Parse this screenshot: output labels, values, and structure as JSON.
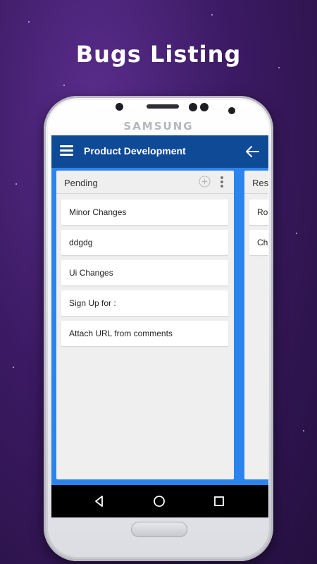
{
  "headline": "Bugs Listing",
  "device": {
    "brand": "SAMSUNG"
  },
  "appbar": {
    "title": "Product Development",
    "color": "#0f4a97"
  },
  "board": {
    "background": "#2b83ee",
    "columns": [
      {
        "title": "Pending",
        "cards": [
          "Minor Changes",
          "ddgdg",
          "Ui Changes",
          "Sign Up for :",
          "Attach URL from comments"
        ]
      },
      {
        "title": "Res",
        "cards": [
          "Ro",
          "Ch"
        ]
      }
    ]
  },
  "icons": {
    "menu": "hamburger-icon",
    "back": "arrow-left-icon",
    "add": "add-circle-icon",
    "more": "more-vertical-icon",
    "nav_back": "triangle-back-icon",
    "nav_home": "circle-home-icon",
    "nav_recent": "square-recent-icon"
  }
}
